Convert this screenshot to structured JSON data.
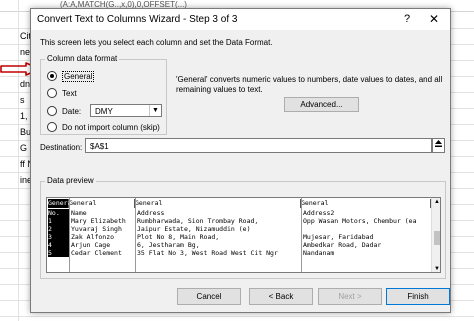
{
  "sheet": {
    "formula_bar": "(A:A,MATCH(G..,x,0),0,OFFSET(...)",
    "rows": [
      "City",
      "ne",
      "dn",
      "s",
      "1,",
      "Bu",
      "G Bu",
      "ff N",
      "ine"
    ]
  },
  "dialog": {
    "title": "Convert Text to Columns Wizard - Step 3 of 3",
    "help": "?",
    "close": "✕",
    "intro": "This screen lets you select each column and set the Data Format.",
    "format_group": {
      "legend": "Column data format",
      "options": [
        {
          "label": "General",
          "selected": true
        },
        {
          "label": "Text",
          "selected": false
        },
        {
          "label": "Date:",
          "selected": false
        },
        {
          "label": "Do not import column (skip)",
          "selected": false
        }
      ],
      "date_value": "DMY"
    },
    "general_note": "'General' converts numeric values to numbers, date values to dates, and all remaining values to text.",
    "advanced_label": "Advanced...",
    "destination": {
      "label": "Destination:",
      "value": "$A$1"
    },
    "preview": {
      "legend": "Data preview",
      "headers": [
        "General",
        "General",
        "General",
        "General"
      ],
      "rows": [
        [
          "No.",
          "Name",
          "Address",
          "Address2"
        ],
        [
          "1",
          "Mary Elizabeth",
          "Rumbharwada, Sion Trombay Road,",
          "Opp Wasan Motors, Chembur (ea"
        ],
        [
          "2",
          "Yuvaraj Singh",
          "Jaipur Estate, Nizamuddin (e)",
          ""
        ],
        [
          "3",
          "Zak Alfonzo",
          "Plot No 8, Main Road,",
          "Mujesar, Faridabad"
        ],
        [
          "4",
          "Arjun Cage",
          "6, Jestharam Bg,",
          "Ambedkar Road, Dadar"
        ],
        [
          "5",
          "Cedar Clement",
          "35 Flat No 3, West Road West Cit Ngr",
          "Nandanam"
        ]
      ]
    },
    "buttons": {
      "cancel": "Cancel",
      "back": "< Back",
      "next": "Next >",
      "finish": "Finish"
    }
  }
}
